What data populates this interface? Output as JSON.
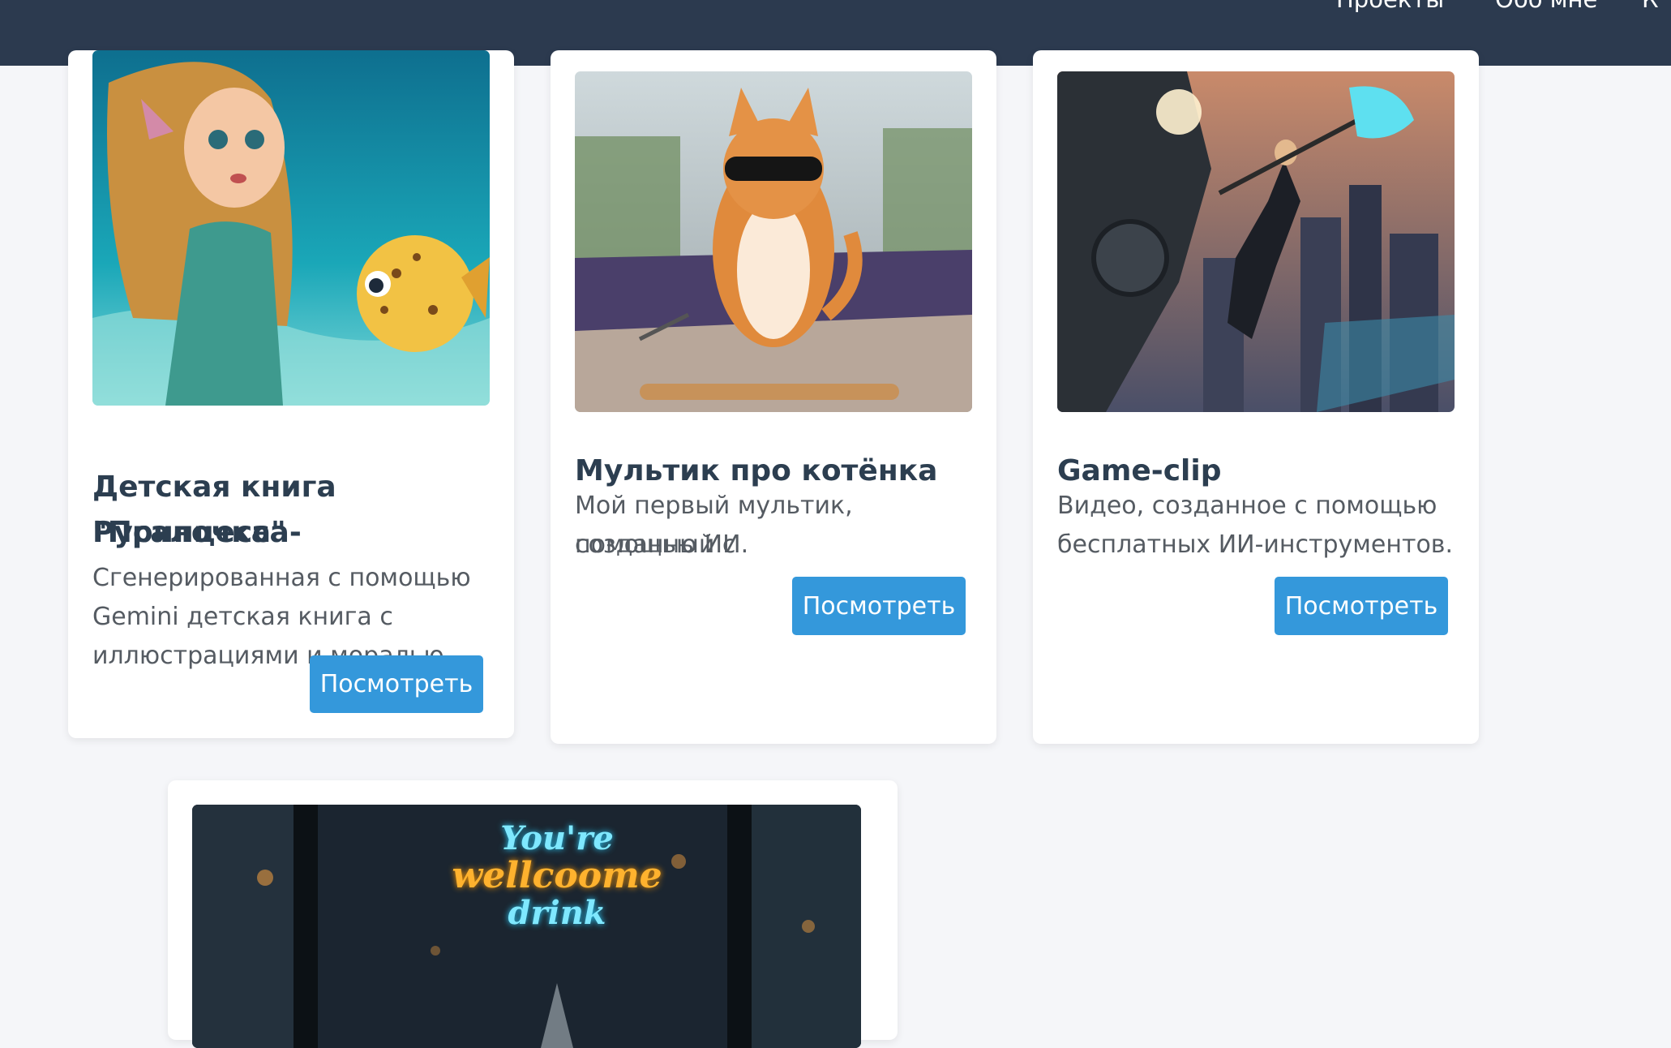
{
  "nav": {
    "items": [
      {
        "label": "Проекты"
      },
      {
        "label": "Обо мне"
      },
      {
        "label": "К"
      }
    ]
  },
  "projects": [
    {
      "title_line1": "Детская книга \"Принцесса-",
      "title_line2": "Русалочка\"",
      "desc_line1": "Сгенерированная с помощью",
      "desc_line2": "Gemini детская книга с",
      "desc_line3": "иллюстрациями и моралью.",
      "button": "Посмотреть",
      "image": "mermaid-illustration"
    },
    {
      "title_line1": "Мультик про котёнка",
      "desc_line1": "Мой первый мультик, созданный с",
      "desc_line2": "помощью ИИ.",
      "button": "Посмотреть",
      "image": "cat-sunglasses-illustration"
    },
    {
      "title_line1": "Game-clip",
      "desc_line1": "Видео, созданное с помощью",
      "desc_line2": "бесплатных ИИ-инструментов.",
      "button": "Посмотреть",
      "image": "robot-battle-illustration"
    },
    {
      "neon_line1": "You're",
      "neon_line2": "wellcoome",
      "neon_line3": "drink",
      "image": "neon-sign-window-illustration"
    }
  ],
  "colors": {
    "header": "#2c3a4f",
    "accent": "#3498db",
    "background": "#f5f6f9"
  }
}
